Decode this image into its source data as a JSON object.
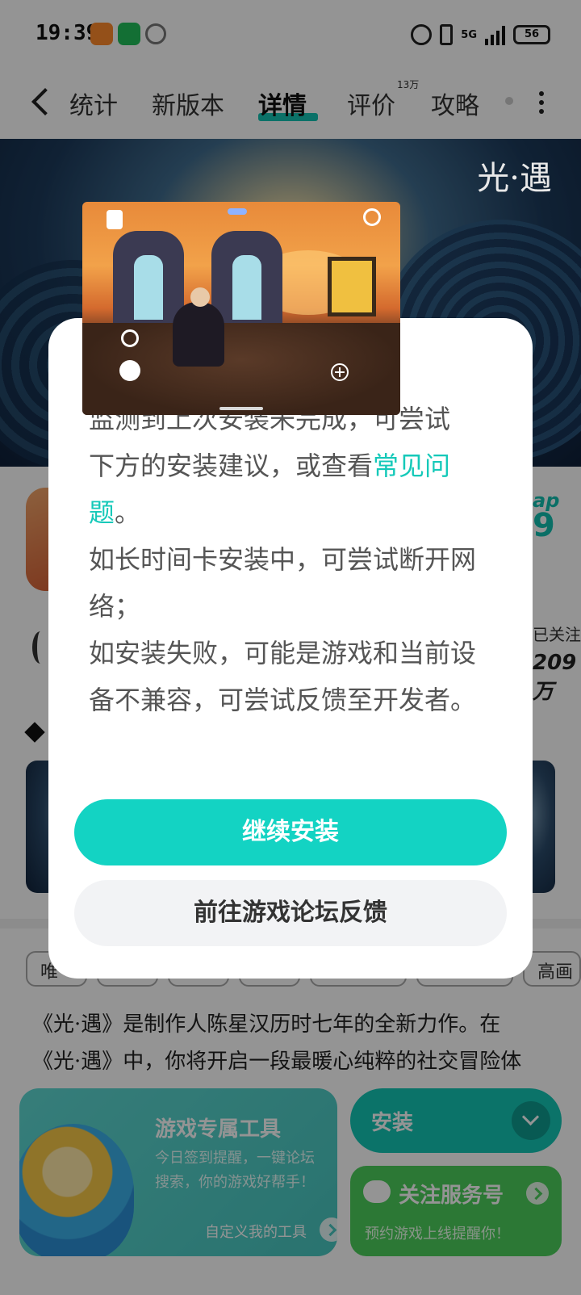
{
  "status_bar": {
    "time": "19:39",
    "network": "5G",
    "battery": "56"
  },
  "nav": {
    "tabs": [
      {
        "label": "统计"
      },
      {
        "label": "新版本"
      },
      {
        "label": "详情",
        "active": true
      },
      {
        "label": "评价",
        "badge": "13万"
      },
      {
        "label": "攻略"
      }
    ]
  },
  "banner": {
    "logo_text": "光·遇"
  },
  "app_info": {
    "tap_label": "ap",
    "rating": "9",
    "follow_label": "已关注",
    "follow_count": "209万"
  },
  "tags": [
    "唯",
    "",
    "",
    "",
    "",
    "",
    "高画"
  ],
  "description": {
    "line1": "《光·遇》是制作人陈星汉历时七年的全新力作。在",
    "line2": "《光·遇》中，你将开启一段最暖心纯粹的社交冒险体"
  },
  "tools_card": {
    "title": "游戏专属工具",
    "subtitle_line1": "今日签到提醒，一键论坛",
    "subtitle_line2": "搜索，你的游戏好帮手！",
    "link": "自定义我的工具"
  },
  "install_button": {
    "label": "安装"
  },
  "service_card": {
    "title": "关注服务号",
    "subtitle": "预约游戏上线提醒你！"
  },
  "dialog": {
    "partial_line": "监测到上次安装未完成，可尝试",
    "para1_line2": "下方的安装建议，或查看",
    "faq_link": "常见问题",
    "para1_end": "。",
    "para2": "如长时间卡安装中，可尝试断开网络；",
    "para3": "如安装失败，可能是游戏和当前设备不兼容，可尝试反馈至开发者。",
    "continue_button": "继续安装",
    "feedback_button": "前往游戏论坛反馈"
  },
  "colors": {
    "accent": "#13d3c3",
    "service_green": "#4ccf5c",
    "scrim": "rgba(0,0,0,0.42)"
  }
}
